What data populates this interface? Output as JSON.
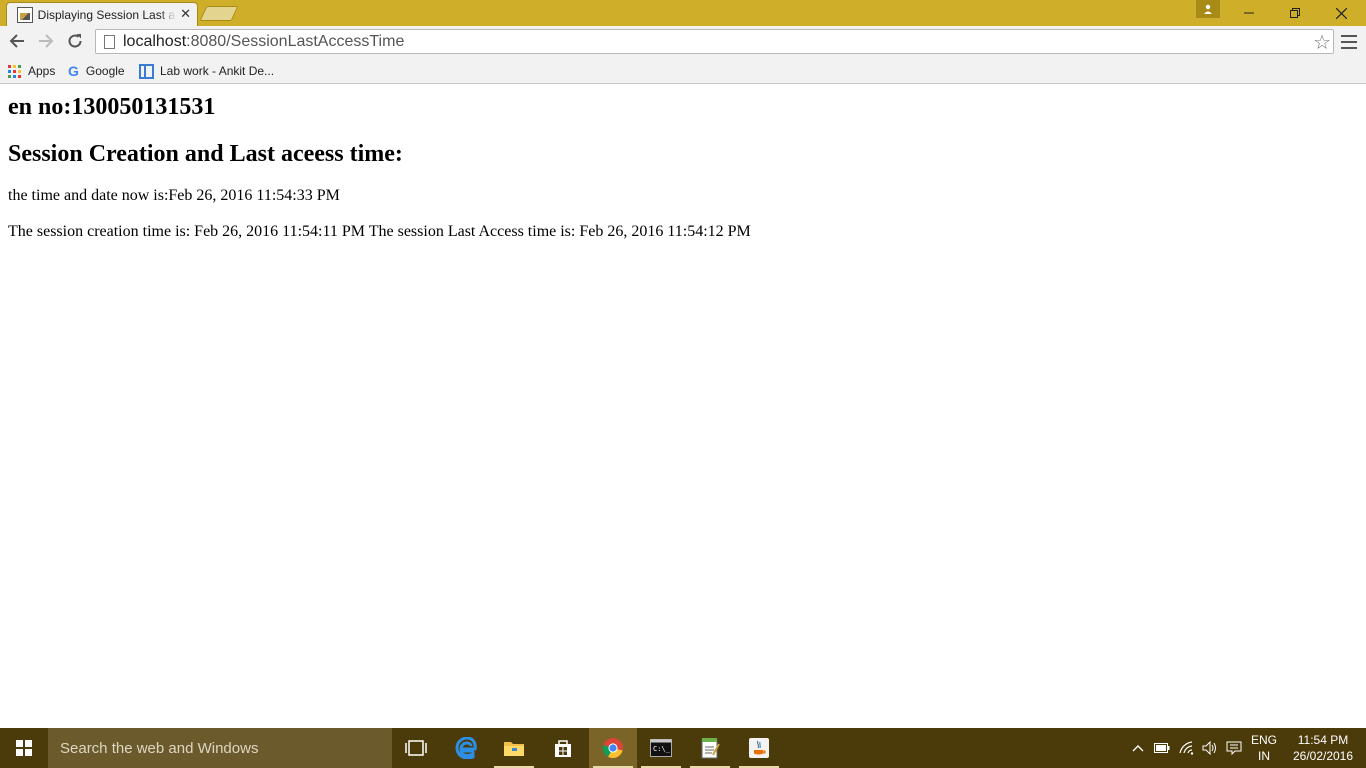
{
  "browser": {
    "tab_title": "Displaying Session Last access Time",
    "address_host": "localhost",
    "address_path": ":8080/SessionLastAccessTime",
    "bookmarks": [
      {
        "label": "Apps",
        "icon": "apps-grid-icon"
      },
      {
        "label": "Google",
        "icon": "google-icon"
      },
      {
        "label": "Lab work - Ankit De...",
        "icon": "lab-work-icon"
      }
    ]
  },
  "page": {
    "heading_enrollment": "en no:130050131531",
    "heading_section": "Session Creation and Last aceess time:",
    "now_text": "the time and date now is:Feb 26, 2016 11:54:33 PM",
    "session_text": "The session creation time is: Feb 26, 2016 11:54:11 PM The session Last Access time is: Feb 26, 2016 11:54:12 PM"
  },
  "taskbar": {
    "search_placeholder": "Search the web and Windows",
    "pinned": [
      "task-view-icon",
      "edge-icon",
      "file-explorer-icon",
      "store-icon",
      "chrome-icon",
      "cmd-icon",
      "notepad-icon",
      "java-icon"
    ],
    "lang_line1": "ENG",
    "lang_line2": "IN",
    "time": "11:54 PM",
    "date": "26/02/2016"
  }
}
